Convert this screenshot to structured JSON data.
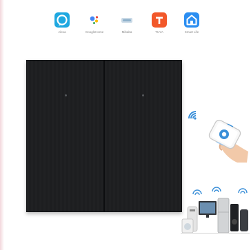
{
  "apps": [
    {
      "label": "Alexa",
      "icon": "alexa-icon",
      "color": "#1fa8e0"
    },
    {
      "label": "GoogleHome",
      "icon": "google-assistant-icon",
      "color": "#4285f4"
    },
    {
      "label": "Mibaba",
      "icon": "mibaba-icon",
      "color": "#9dbbd3"
    },
    {
      "label": "TUYA",
      "icon": "tuya-icon",
      "color": "#f2582a"
    },
    {
      "label": "Smart Life",
      "icon": "smart-life-icon",
      "color": "#2b8ef1"
    }
  ],
  "panel": {
    "color": "#1b1c1e",
    "gangs": 2
  }
}
